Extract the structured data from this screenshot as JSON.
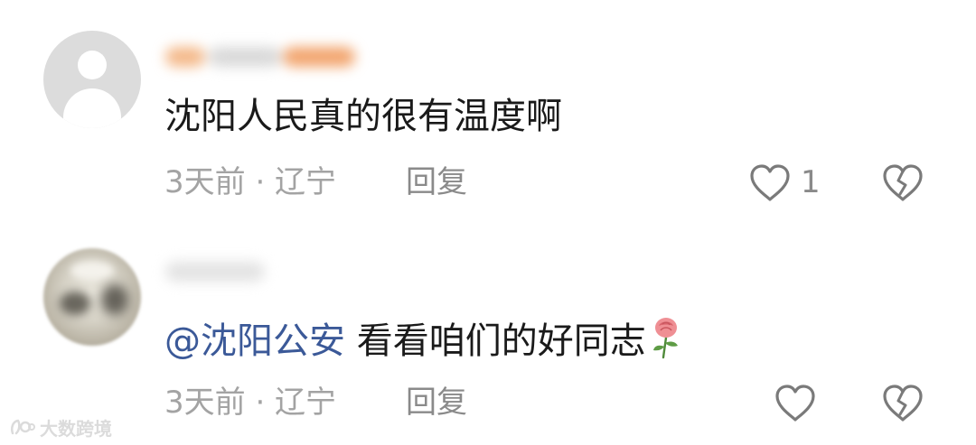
{
  "comments": [
    {
      "text": "沈阳人民真的很有温度啊",
      "meta": "3天前 · 辽宁",
      "reply_label": "回复",
      "like_count": "1"
    },
    {
      "mention": "@沈阳公安",
      "text": " 看看咱们的好同志",
      "emoji": "rose",
      "meta": "3天前 · 辽宁",
      "reply_label": "回复"
    }
  ],
  "watermark": {
    "text": "大数跨境"
  },
  "colors": {
    "mention": "#3b5998",
    "text": "#1a1a1a",
    "meta": "#a3a3a3",
    "icon": "#7a7a7a"
  }
}
